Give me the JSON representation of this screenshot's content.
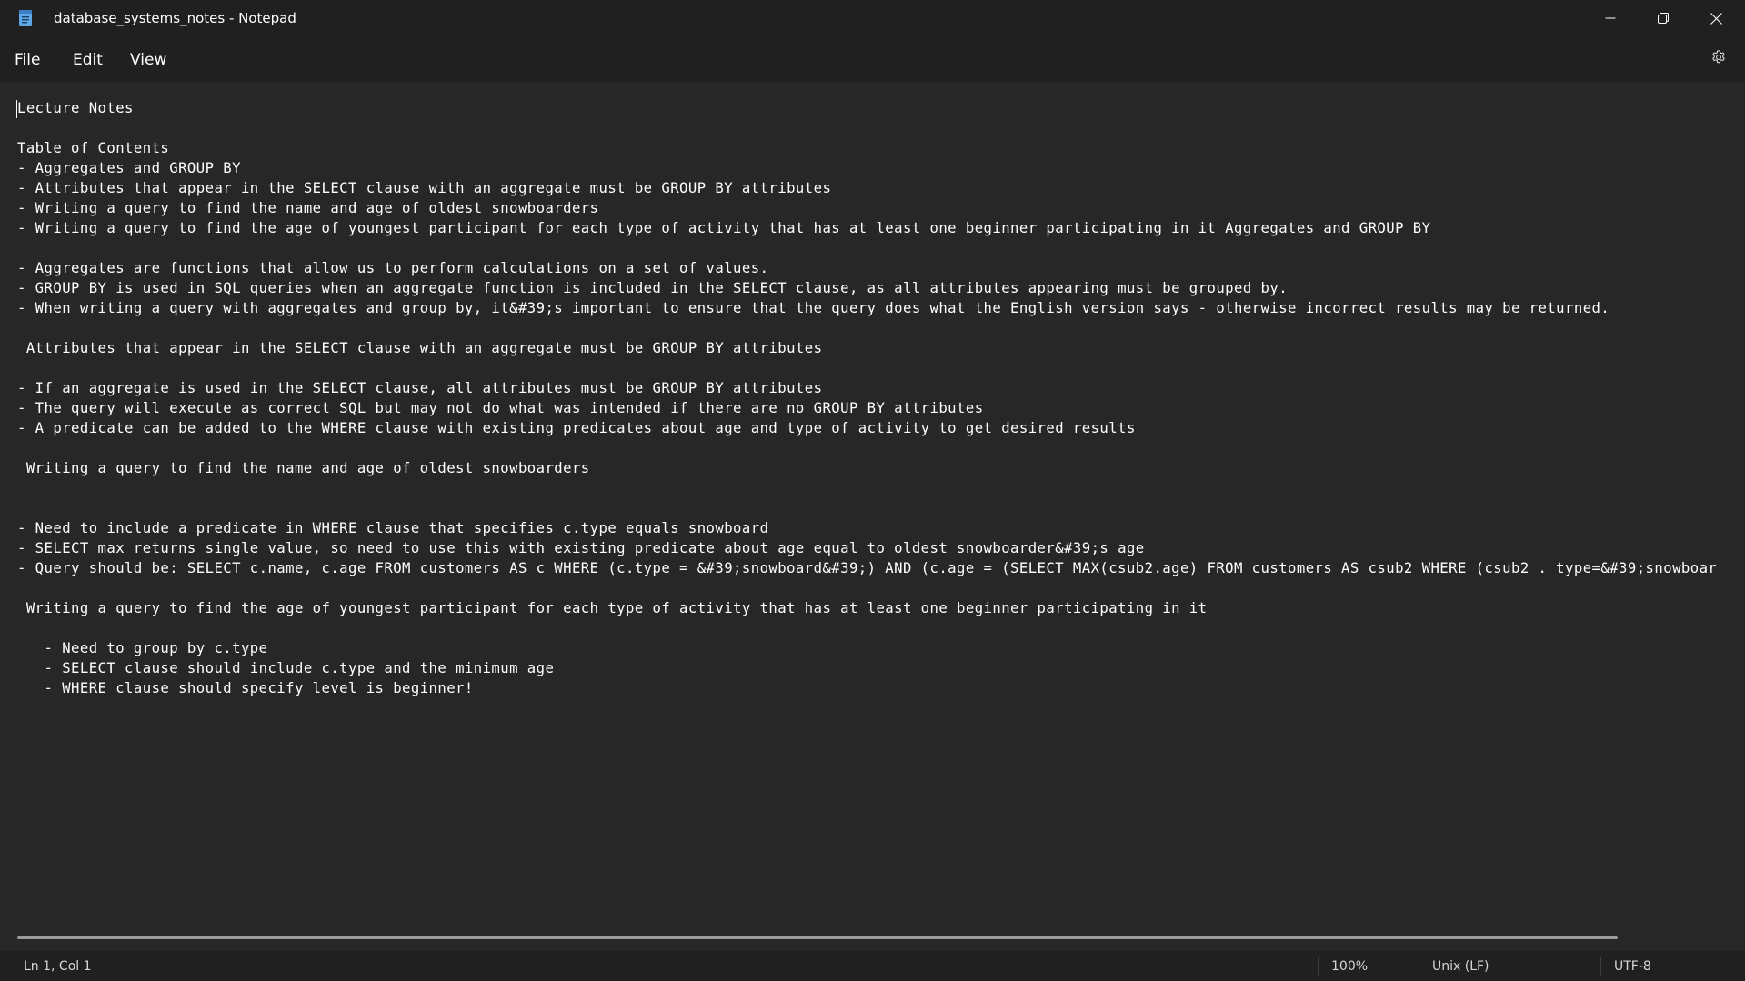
{
  "window": {
    "title": "database_systems_notes - Notepad",
    "controls": {
      "minimize": "minimize-icon",
      "maximize": "restore-icon",
      "close": "close-icon"
    }
  },
  "menu": {
    "file": "File",
    "edit": "Edit",
    "view": "View",
    "settings_icon": "gear-icon"
  },
  "editor": {
    "content": "Lecture Notes\n\nTable of Contents\n- Aggregates and GROUP BY\n- Attributes that appear in the SELECT clause with an aggregate must be GROUP BY attributes\n- Writing a query to find the name and age of oldest snowboarders\n- Writing a query to find the age of youngest participant for each type of activity that has at least one beginner participating in it Aggregates and GROUP BY\n\n- Aggregates are functions that allow us to perform calculations on a set of values.\n- GROUP BY is used in SQL queries when an aggregate function is included in the SELECT clause, as all attributes appearing must be grouped by.\n- When writing a query with aggregates and group by, it&#39;s important to ensure that the query does what the English version says - otherwise incorrect results may be returned.\n\n Attributes that appear in the SELECT clause with an aggregate must be GROUP BY attributes\n\n- If an aggregate is used in the SELECT clause, all attributes must be GROUP BY attributes\n- The query will execute as correct SQL but may not do what was intended if there are no GROUP BY attributes\n- A predicate can be added to the WHERE clause with existing predicates about age and type of activity to get desired results\n\n Writing a query to find the name and age of oldest snowboarders\n\n\n- Need to include a predicate in WHERE clause that specifies c.type equals snowboard\n- SELECT max returns single value, so need to use this with existing predicate about age equal to oldest snowboarder&#39;s age\n- Query should be: SELECT c.name, c.age FROM customers AS c WHERE (c.type = &#39;snowboard&#39;) AND (c.age = (SELECT MAX(csub2.age) FROM customers AS csub2 WHERE (csub2 . type=&#39;snowboar\n\n Writing a query to find the age of youngest participant for each type of activity that has at least one beginner participating in it\n\n   - Need to group by c.type\n   - SELECT clause should include c.type and the minimum age\n   - WHERE clause should specify level is beginner!"
  },
  "status": {
    "position": "Ln 1, Col 1",
    "zoom": "100%",
    "line_ending": "Unix (LF)",
    "encoding": "UTF-8"
  }
}
